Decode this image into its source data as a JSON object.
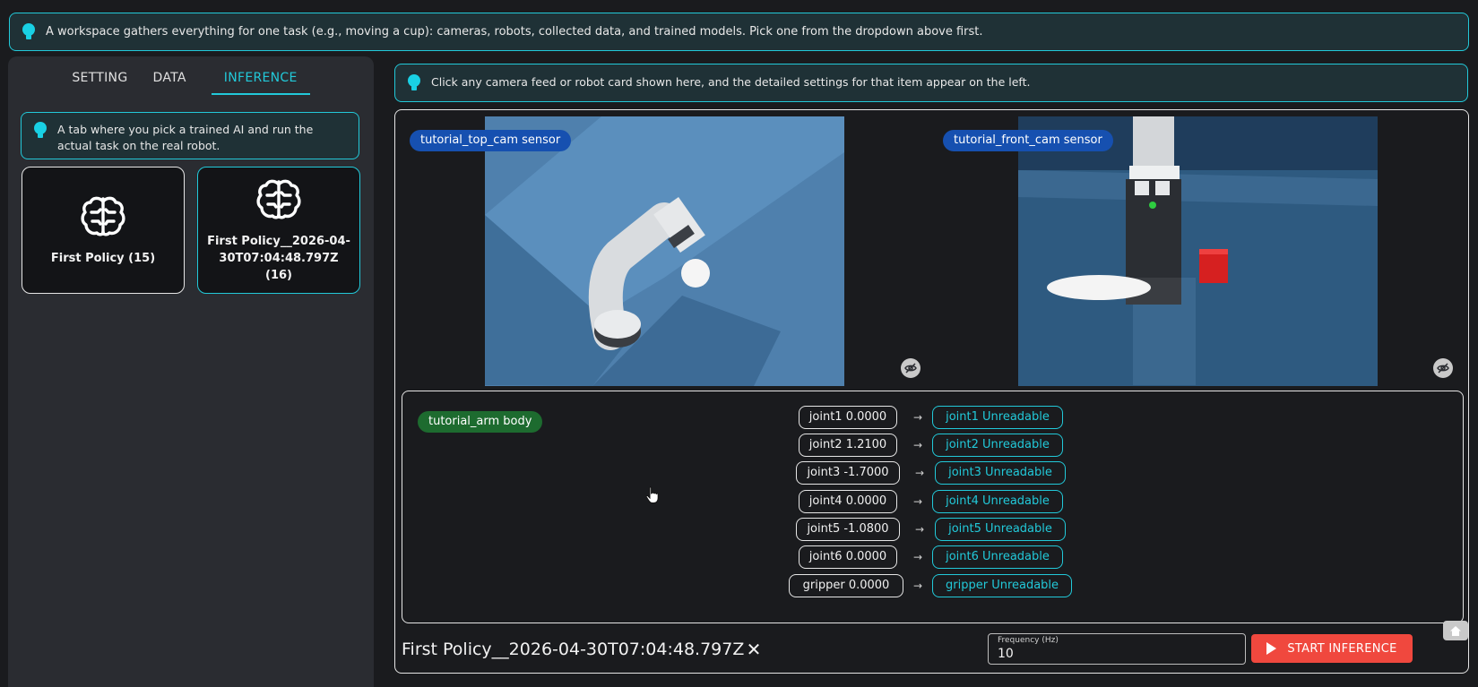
{
  "top_tip": {
    "icon": "lightbulb-icon",
    "text": "A workspace gathers everything for one task (e.g., moving a cup): cameras, robots, collected data, and trained models. Pick one from the dropdown above first."
  },
  "sidebar": {
    "tabs": [
      {
        "label": "SETTING",
        "active": false
      },
      {
        "label": "DATA",
        "active": false
      },
      {
        "label": "INFERENCE",
        "active": true
      }
    ],
    "tip": "A tab where you pick a trained AI and run the actual task on the real robot.",
    "policies": [
      {
        "name": "First Policy (15)",
        "icon": "brain-icon",
        "selected": false
      },
      {
        "name": "First Policy__2026-04-30T07:04:48.797Z (16)",
        "icon": "brain-icon",
        "selected": true
      }
    ]
  },
  "right_tip": {
    "icon": "lightbulb-icon",
    "text": "Click any camera feed or robot card shown here, and the detailed settings for that item appear on the left."
  },
  "cameras": [
    {
      "label": "tutorial_top_cam sensor",
      "visibility_icon": "eye-off-icon"
    },
    {
      "label": "tutorial_front_cam sensor",
      "visibility_icon": "eye-off-icon"
    }
  ],
  "arm": {
    "label": "tutorial_arm body",
    "joints": [
      {
        "value": "joint1 0.0000",
        "output": "joint1 Unreadable"
      },
      {
        "value": "joint2 1.2100",
        "output": "joint2 Unreadable"
      },
      {
        "value": "joint3 -1.7000",
        "output": "joint3 Unreadable"
      },
      {
        "value": "joint4 0.0000",
        "output": "joint4 Unreadable"
      },
      {
        "value": "joint5 -1.0800",
        "output": "joint5 Unreadable"
      },
      {
        "value": "joint6 0.0000",
        "output": "joint6 Unreadable"
      },
      {
        "value": "gripper 0.0000",
        "output": "gripper Unreadable"
      }
    ],
    "arrow": "→"
  },
  "bottom": {
    "selected_policy": "First Policy__2026-04-30T07:04:48.797Z",
    "clear_icon": "✕",
    "frequency_label": "Frequency (Hz)",
    "frequency_value": "10",
    "start_label": "START INFERENCE"
  },
  "colors": {
    "accent": "#22c9d9",
    "sensor_pill": "#1650b0",
    "body_pill": "#1d6b2f",
    "start_button": "#f0483e"
  }
}
